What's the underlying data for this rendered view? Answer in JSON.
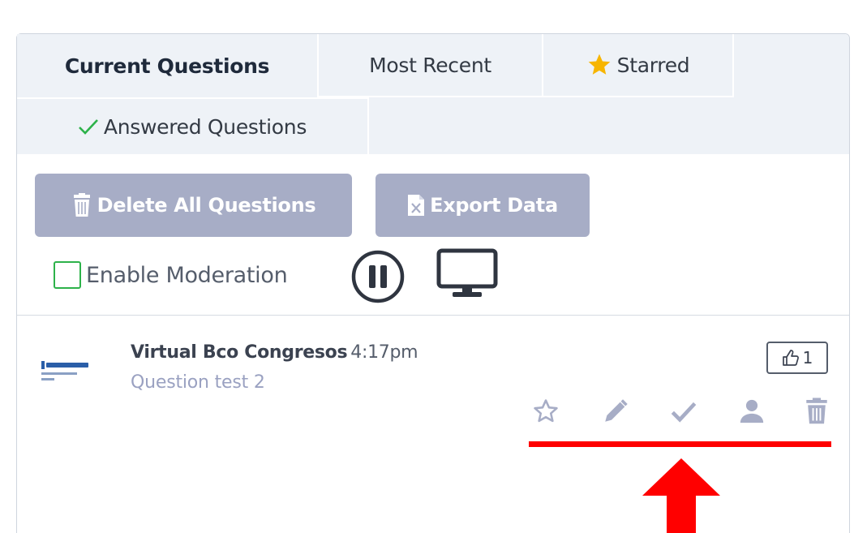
{
  "tabs": {
    "current": "Current Questions",
    "recent": "Most Recent",
    "starred": "Starred",
    "answered": "Answered Questions"
  },
  "buttons": {
    "delete_all": "Delete All Questions",
    "export": "Export Data"
  },
  "moderation": {
    "label": "Enable Moderation",
    "checked": false
  },
  "question": {
    "author": "Virtual Bco Congresos",
    "time": "4:17pm",
    "text": "Question test 2",
    "likes": "1"
  },
  "colors": {
    "tab_bg": "#eef2f7",
    "button_bg": "#a7adc6",
    "checkbox_border": "#2db24a",
    "check_green": "#2db24a",
    "star_yellow": "#f7b500",
    "action_icon": "#a7adc6",
    "annotation_red": "#ff0000"
  },
  "icons": {
    "starred_tab": "star-icon",
    "answered_tab": "checkmark-icon",
    "delete": "trash-icon",
    "export": "file-excel-icon",
    "pause": "pause-circle-icon",
    "monitor": "monitor-icon",
    "like": "thumbs-up-icon",
    "actions": [
      "star-outline-icon",
      "pencil-icon",
      "checkmark-icon",
      "user-icon",
      "trash-icon"
    ]
  }
}
